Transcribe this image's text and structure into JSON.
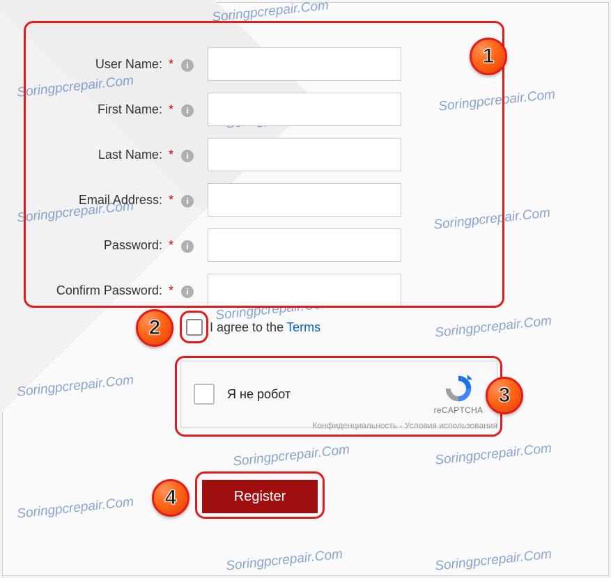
{
  "watermark_text": "Soringpcrepair.Com",
  "form": {
    "fields": [
      {
        "label": "User Name:",
        "value": ""
      },
      {
        "label": "First Name:",
        "value": ""
      },
      {
        "label": "Last Name:",
        "value": ""
      },
      {
        "label": "Email Address:",
        "value": ""
      },
      {
        "label": "Password:",
        "value": ""
      },
      {
        "label": "Confirm Password:",
        "value": ""
      }
    ],
    "required_mark": "*"
  },
  "terms": {
    "checked": false,
    "text_part1": "I agree to the",
    "link_text": "Terms"
  },
  "captcha": {
    "checked": false,
    "label": "Я не робот",
    "brand": "reCAPTCHA",
    "footer": "Конфиденциальность - Условия использования"
  },
  "register_button": "Register",
  "annotations": {
    "badge1": "1",
    "badge2": "2",
    "badge3": "3",
    "badge4": "4"
  }
}
